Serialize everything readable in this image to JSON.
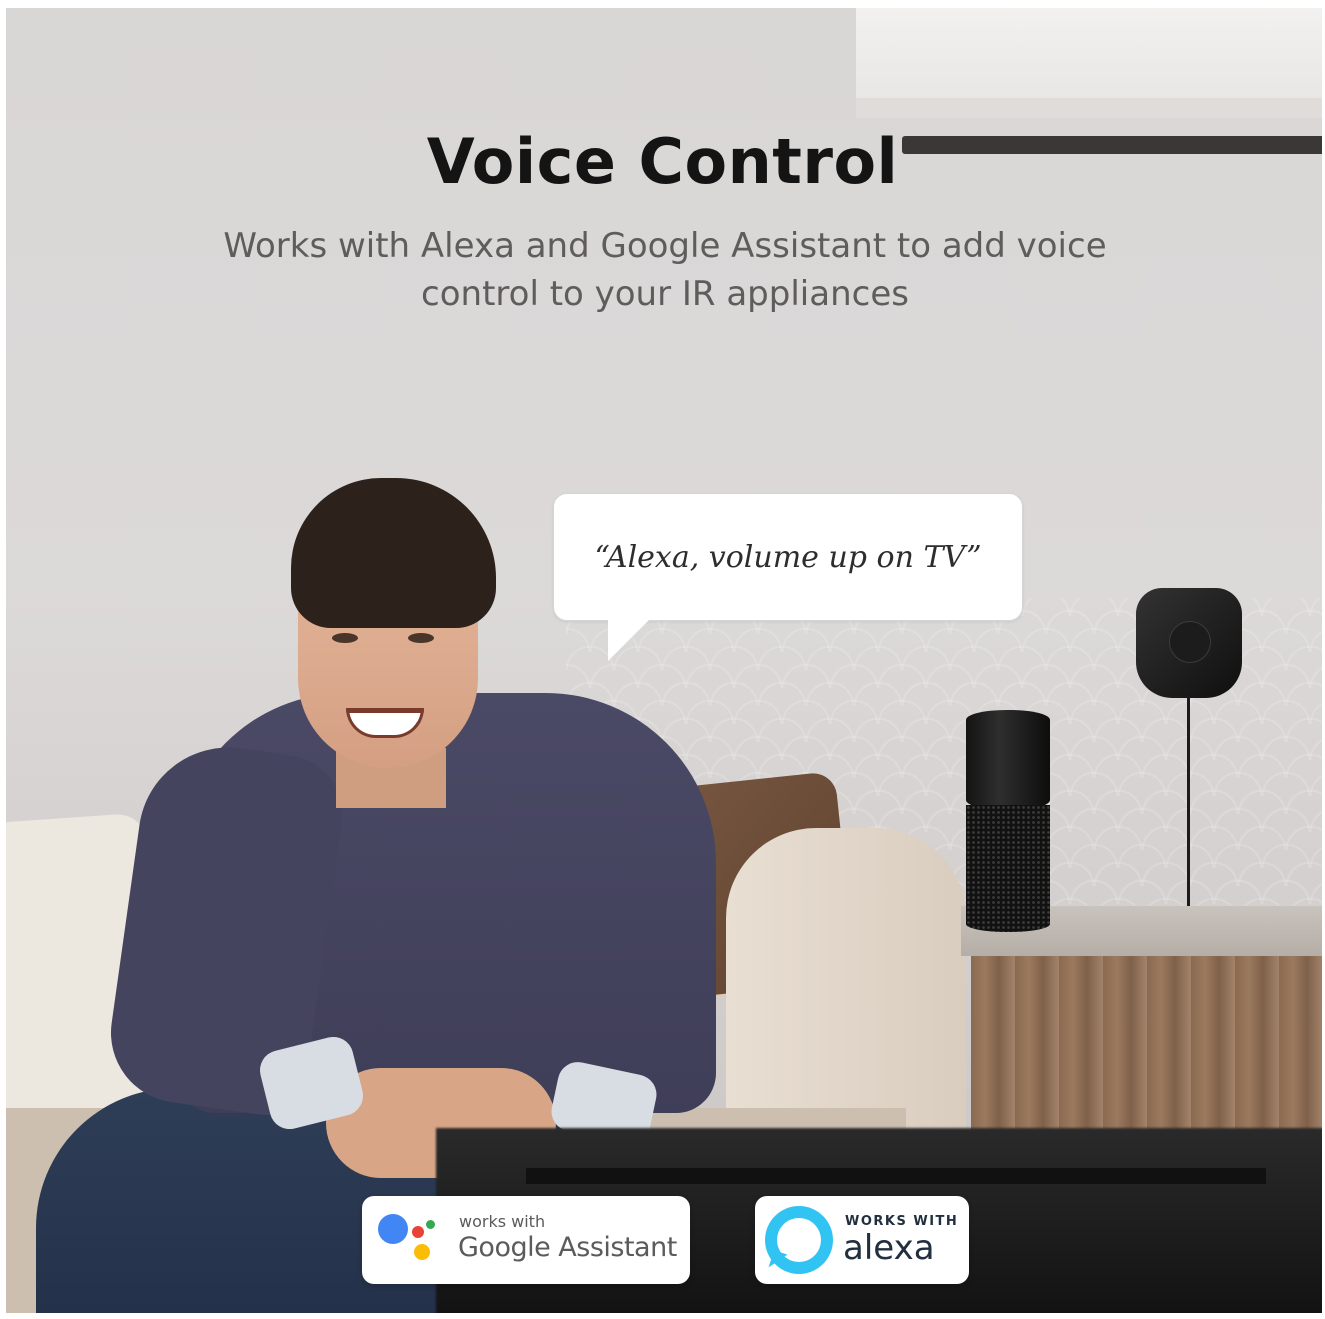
{
  "header": {
    "title": "Voice Control",
    "subtitle": "Works with Alexa and Google Assistant to add voice control to your IR appliances"
  },
  "speech_bubble": {
    "text": "“Alexa, volume up on TV”"
  },
  "badges": {
    "google": {
      "small": "works with",
      "big": "Google Assistant",
      "icon": "google-assistant-icon",
      "colors": [
        "#4285f4",
        "#ea4335",
        "#fbbc05",
        "#34a853"
      ]
    },
    "alexa": {
      "small": "WORKS WITH",
      "big": "alexa",
      "icon": "alexa-icon",
      "color": "#31c4f3"
    }
  }
}
